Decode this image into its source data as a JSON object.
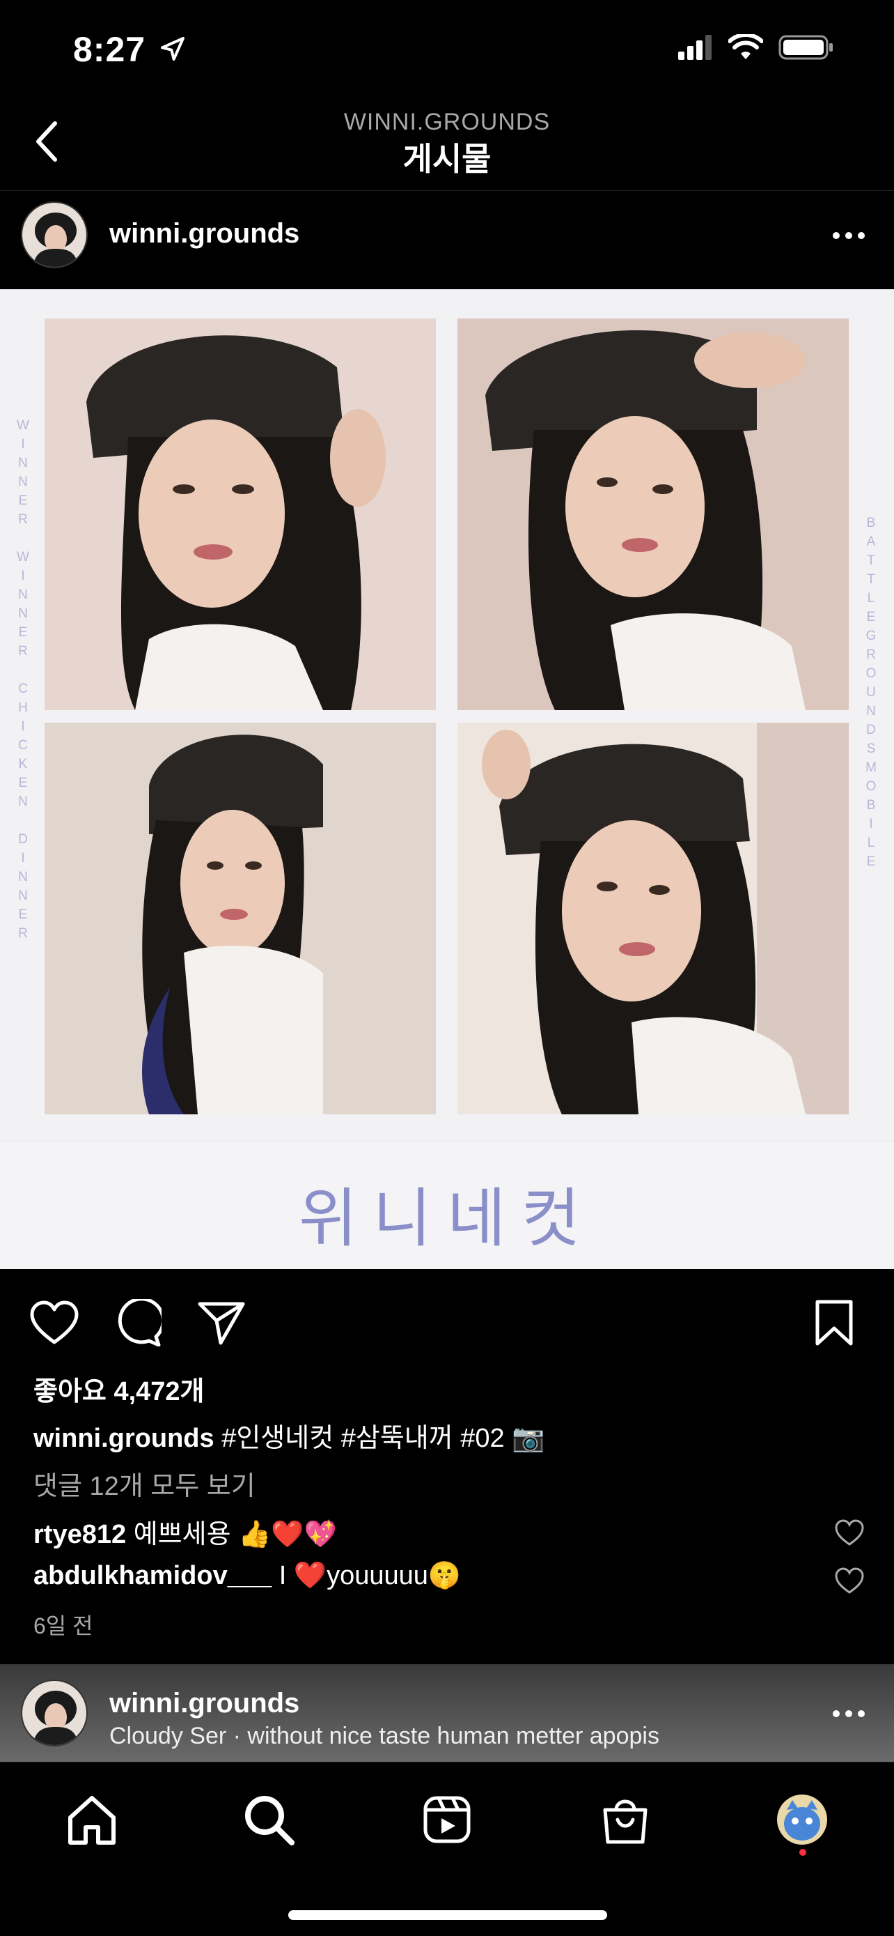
{
  "status_bar": {
    "time": "8:27"
  },
  "nav": {
    "subtitle": "WINNI.GROUNDS",
    "title": "게시물"
  },
  "post": {
    "username": "winni.grounds",
    "image": {
      "left_vertical_text": "WINNER WINNER CHICKEN DINNER",
      "right_vertical_text": "BATTLEGROUNDSMOBILE",
      "caption": "위니네컷"
    },
    "likes_text": "좋아요 4,472개",
    "caption": {
      "username": "winni.grounds",
      "text": "#인생네컷 #삼뚝내꺼 #02 📷"
    },
    "view_comments": "댓글 12개 모두 보기",
    "comments": [
      {
        "username": "rtye812",
        "text": "예쁘세용 👍❤️💖"
      },
      {
        "username": "abdulkhamidov___",
        "text": "I ❤️youuuuu🤫"
      }
    ],
    "time_ago": "6일 전"
  },
  "next_post": {
    "username": "winni.grounds",
    "audio": "Cloudy Ser · without nice taste human metter apopis"
  },
  "tabbar": {
    "items": [
      "home-icon",
      "search-icon",
      "reels-icon",
      "shop-icon",
      "profile-avatar"
    ]
  },
  "colors": {
    "background": "#000000",
    "accent_text": "#8b8fc9",
    "notification": "#ff3040"
  }
}
